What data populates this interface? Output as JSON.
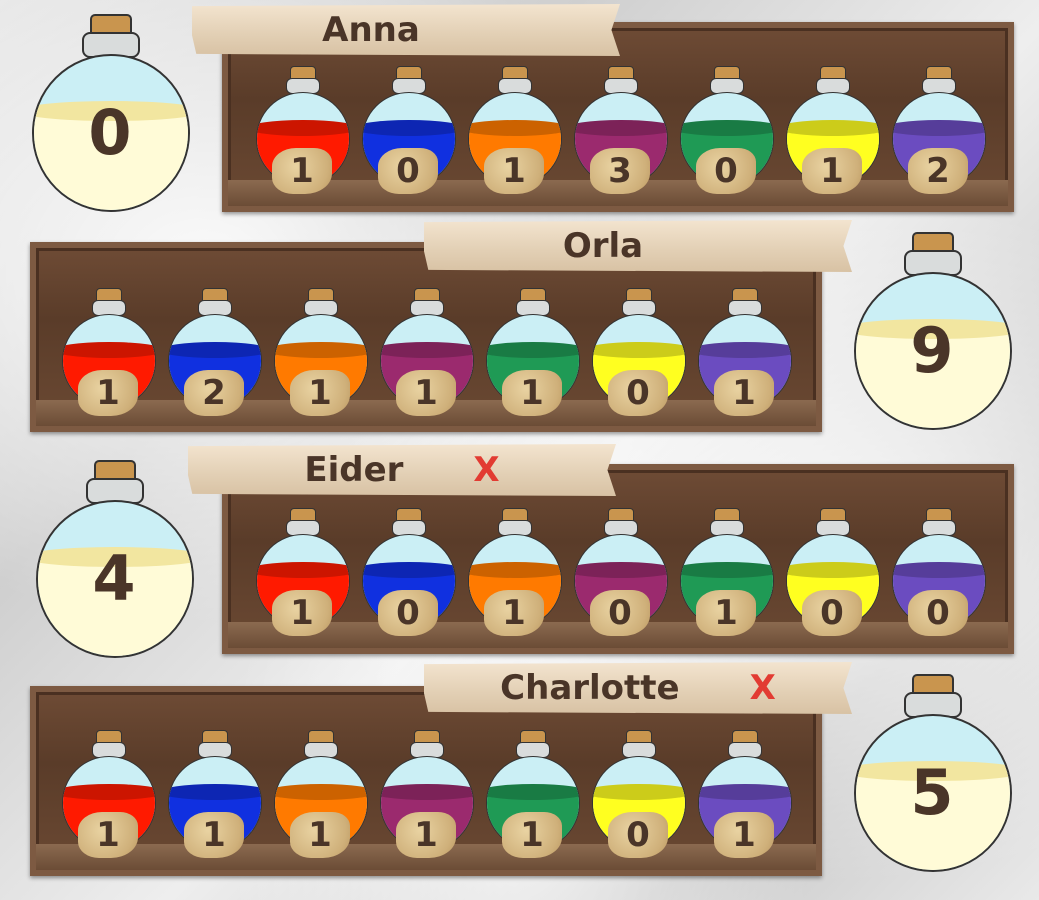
{
  "colors": {
    "red": "#ff1a00",
    "blue": "#1030e0",
    "orange": "#ff7a00",
    "purple": "#9b2a6e",
    "green": "#1f9a55",
    "yellow": "#ffff20",
    "violet": "#6b4cc0"
  },
  "players": [
    {
      "name": "Anna",
      "mark": "",
      "score": "0",
      "potions": [
        {
          "color": "red",
          "count": "1"
        },
        {
          "color": "blue",
          "count": "0"
        },
        {
          "color": "orange",
          "count": "1"
        },
        {
          "color": "purple",
          "count": "3"
        },
        {
          "color": "green",
          "count": "0"
        },
        {
          "color": "yellow",
          "count": "1"
        },
        {
          "color": "violet",
          "count": "2"
        }
      ]
    },
    {
      "name": "Orla",
      "mark": "",
      "score": "9",
      "potions": [
        {
          "color": "red",
          "count": "1"
        },
        {
          "color": "blue",
          "count": "2"
        },
        {
          "color": "orange",
          "count": "1"
        },
        {
          "color": "purple",
          "count": "1"
        },
        {
          "color": "green",
          "count": "1"
        },
        {
          "color": "yellow",
          "count": "0"
        },
        {
          "color": "violet",
          "count": "1"
        }
      ]
    },
    {
      "name": "Eider",
      "mark": "X",
      "score": "4",
      "potions": [
        {
          "color": "red",
          "count": "1"
        },
        {
          "color": "blue",
          "count": "0"
        },
        {
          "color": "orange",
          "count": "1"
        },
        {
          "color": "purple",
          "count": "0"
        },
        {
          "color": "green",
          "count": "1"
        },
        {
          "color": "yellow",
          "count": "0"
        },
        {
          "color": "violet",
          "count": "0"
        }
      ]
    },
    {
      "name": "Charlotte",
      "mark": "X",
      "score": "5",
      "potions": [
        {
          "color": "red",
          "count": "1"
        },
        {
          "color": "blue",
          "count": "1"
        },
        {
          "color": "orange",
          "count": "1"
        },
        {
          "color": "purple",
          "count": "1"
        },
        {
          "color": "green",
          "count": "1"
        },
        {
          "color": "yellow",
          "count": "0"
        },
        {
          "color": "violet",
          "count": "1"
        }
      ]
    }
  ]
}
